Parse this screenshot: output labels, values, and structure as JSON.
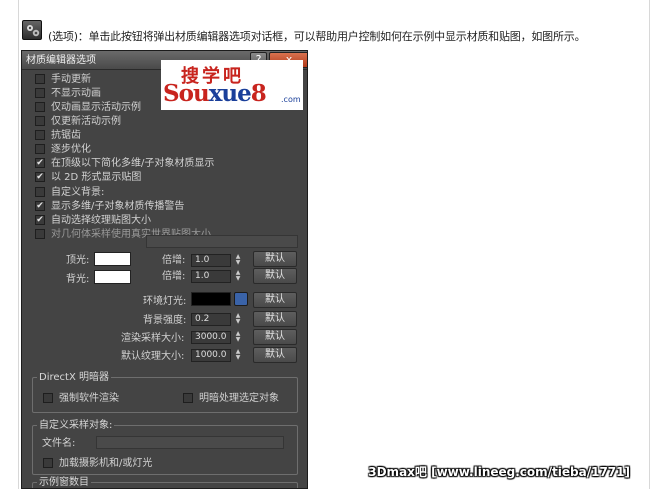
{
  "intro": {
    "icon": "material-editor-options-icon",
    "text": "(选项)：单击此按钮将弹出材质编辑器选项对话框，可以帮助用户控制如何在示例中显示材质和贴图，如图所示。"
  },
  "dialog": {
    "title": "材质编辑器选项",
    "help_label": "?",
    "close_label": "x",
    "options": [
      {
        "label": "手动更新",
        "checked": false
      },
      {
        "label": "不显示动画",
        "checked": false
      },
      {
        "label": "仅动画显示活动示例",
        "checked": false
      },
      {
        "label": "仅更新活动示例",
        "checked": false
      },
      {
        "label": "抗锯齿",
        "checked": false
      },
      {
        "label": "逐步优化",
        "checked": false
      },
      {
        "label": "在顶级以下简化多维/子对象材质显示",
        "checked": true
      },
      {
        "label": "以 2D 形式显示贴图",
        "checked": true
      },
      {
        "label": "自定义背景:",
        "checked": false
      },
      {
        "label": "显示多维/子对象材质传播警告",
        "checked": true
      },
      {
        "label": "自动选择纹理贴图大小",
        "checked": true
      },
      {
        "label": "对几何体采样使用真实世界贴图大小",
        "checked": false
      }
    ],
    "lights": {
      "top_label": "顶光:",
      "back_label": "背光:",
      "top_color": "#ffffff",
      "back_color": "#ffffff",
      "multiplier_label": "倍增:",
      "top_multiplier": "1.0",
      "back_multiplier": "1.0",
      "ambient_label": "环境灯光:",
      "ambient_color": "#000000",
      "bg_intensity_label": "背景强度:",
      "bg_intensity": "0.2",
      "render_sample_label": "渲染采样大小:",
      "render_sample": "3000.0",
      "default_texture_label": "默认纹理大小:",
      "default_texture": "1000.0",
      "default_button": "默认"
    },
    "directx": {
      "title": "DirectX 明暗器",
      "force_software": "强制软件渲染",
      "shade_selected": "明暗处理选定对象"
    },
    "custom_sample": {
      "title": "自定义采样对象:",
      "file_label": "文件名:",
      "load_camera": "加载摄影机和/或灯光"
    },
    "sample_slots": {
      "title": "示例窗数目"
    }
  },
  "logo": {
    "top": "搜学吧",
    "bottom_a": "Sou",
    "bottom_b": "xue",
    "bottom_c": "8",
    "domain": ".com"
  },
  "watermark": "3Dmax吧 [www.lineeg.com/tieba/1771]"
}
